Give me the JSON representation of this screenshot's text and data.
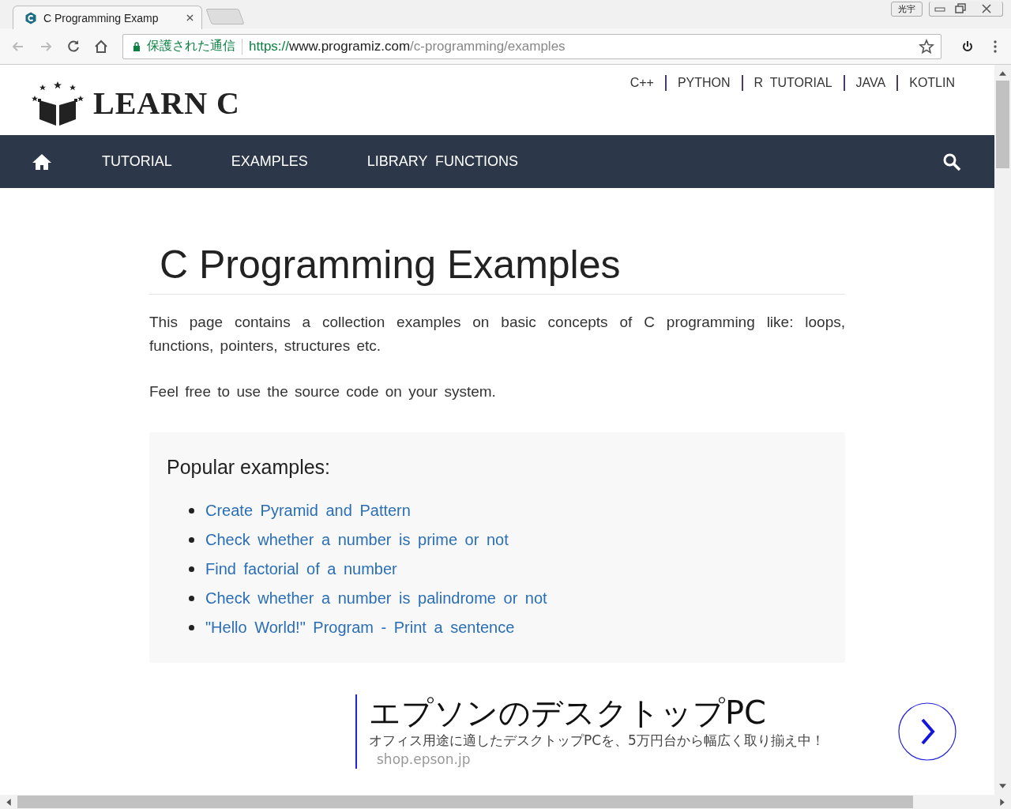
{
  "browser": {
    "tab_title": "C Programming Examp",
    "ime_label": "光宇",
    "secure_label": "保護された通信",
    "url": {
      "scheme": "https://",
      "host": "www.programiz.com",
      "path": "/c-programming/examples"
    }
  },
  "header": {
    "logo": "LEARN C",
    "top_links": [
      "C++",
      "PYTHON",
      "R  TUTORIAL",
      "JAVA",
      "KOTLIN"
    ]
  },
  "nav": {
    "items": [
      "TUTORIAL",
      "EXAMPLES",
      "LIBRARY  FUNCTIONS"
    ]
  },
  "content": {
    "title": "C Programming Examples",
    "paragraphs": [
      "This page contains a collection examples on basic concepts of C programming like: loops, functions, pointers, structures etc.",
      "Feel free to use the source code on your system."
    ],
    "popular": {
      "heading": "Popular examples:",
      "links": [
        "Create Pyramid and Pattern",
        "Check whether a number is prime or not",
        "Find factorial of a number",
        "Check whether a number is palindrome or not",
        "\"Hello World!\" Program - Print a sentence"
      ]
    }
  },
  "ad": {
    "title": "エプソンのデスクトップPC",
    "description": "オフィス用途に適したデスクトップPCを、5万円台から幅広く取り揃え中！",
    "domain": "shop.epson.jp"
  }
}
